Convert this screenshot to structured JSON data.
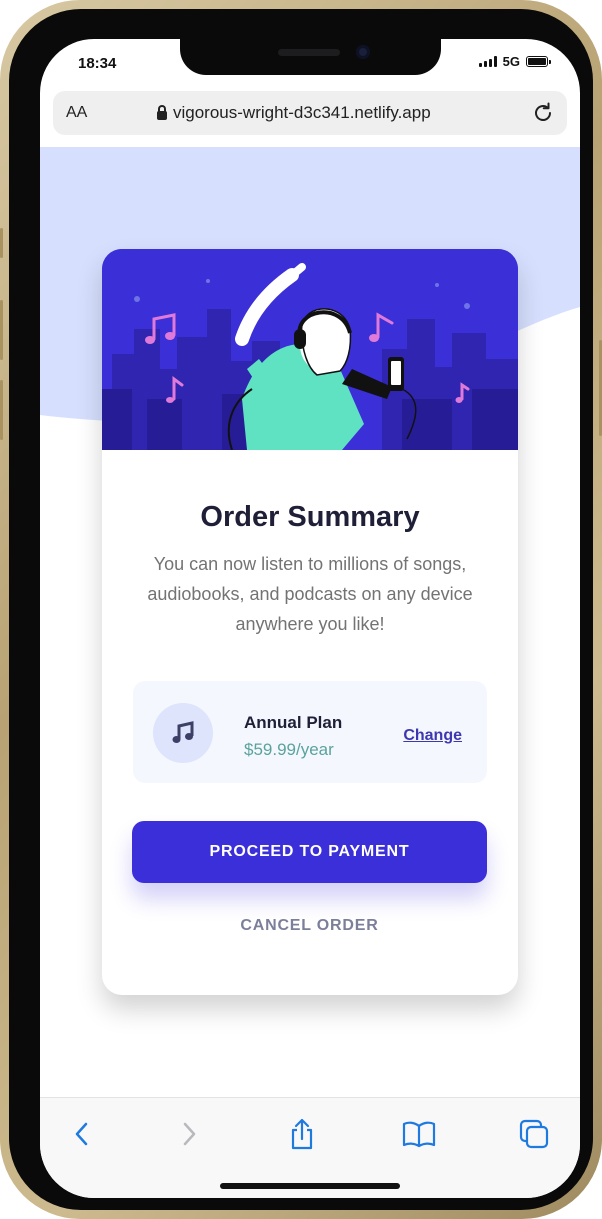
{
  "status_bar": {
    "time": "18:34",
    "network": "5G"
  },
  "browser": {
    "text_size_label": "AA",
    "url": "vigorous-wright-d3c341.netlify.app",
    "icons": {
      "lock": "lock-icon",
      "reload": "reload-icon",
      "back": "chevron-left-icon",
      "forward": "chevron-right-icon",
      "share": "share-icon",
      "bookmarks": "book-icon",
      "tabs": "tabs-icon"
    }
  },
  "card": {
    "title": "Order Summary",
    "description": "You can now listen to millions of songs, audiobooks, and podcasts on any device anywhere you like!",
    "plan": {
      "icon": "music-note-icon",
      "name": "Annual Plan",
      "price": "$59.99/year",
      "change_label": "Change"
    },
    "proceed_label": "PROCEED TO PAYMENT",
    "cancel_label": "CANCEL ORDER"
  },
  "colors": {
    "accent": "#3a2fd9",
    "page_pattern": "#d6e0fe",
    "price": "#5aa39b",
    "link": "#3d38b0",
    "ios_blue": "#1f7ae0"
  }
}
